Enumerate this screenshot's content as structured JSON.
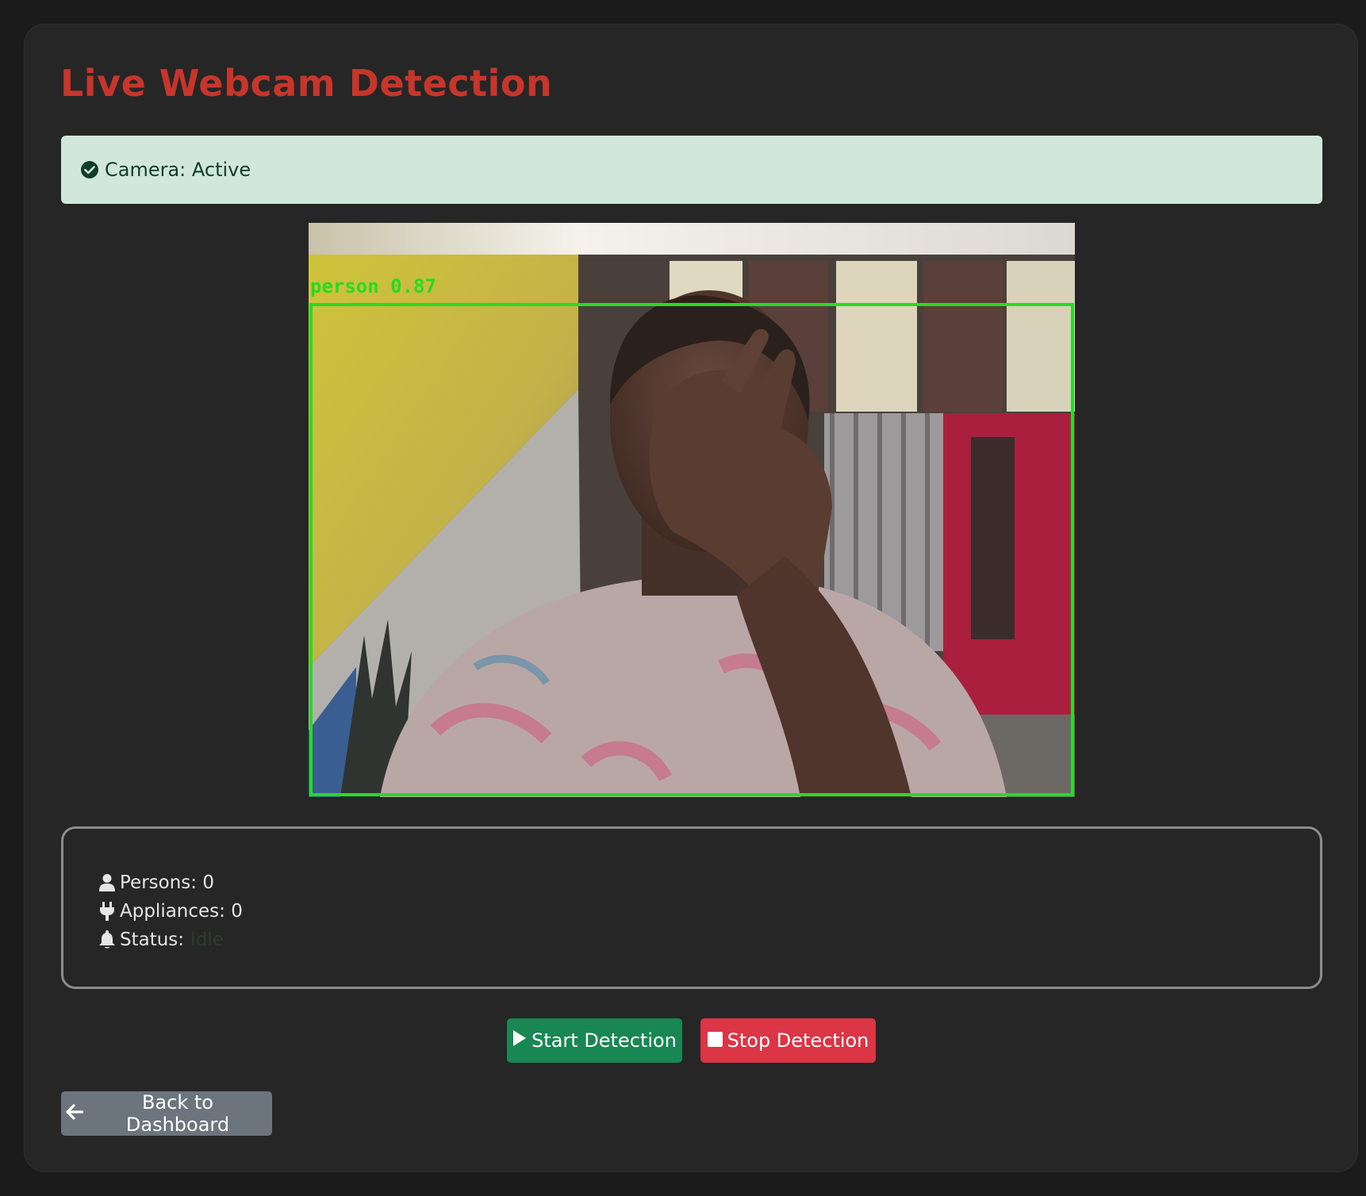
{
  "page": {
    "title": "Live Webcam Detection"
  },
  "camera_alert": {
    "icon": "check-circle-icon",
    "text": "Camera: Active",
    "color": "#d1e7dd"
  },
  "video_feed": {
    "detection_label": "person 0.87",
    "box_color": "#22dd22"
  },
  "stats": {
    "persons": "Persons: 0",
    "appliances": "Appliances: 0",
    "status_label": "Status:",
    "status_value": "Idle",
    "icons": [
      "person-icon",
      "plug-icon",
      "bell-icon"
    ]
  },
  "controls": {
    "start_label": "Start Detection",
    "stop_label": "Stop Detection",
    "back_label": "Back to Dashboard",
    "start_color": "#198754",
    "stop_color": "#dc3545",
    "back_color": "#6c757d"
  }
}
